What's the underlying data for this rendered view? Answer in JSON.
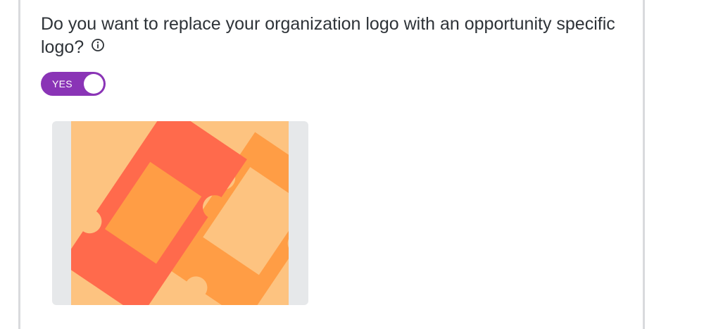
{
  "question": {
    "text": "Do you want to replace your organization logo with an opportunity specific logo?",
    "info_icon": "info-circle-icon"
  },
  "toggle": {
    "label": "YES",
    "state": "on",
    "color": "#8a34b6"
  },
  "logo": {
    "icon": "tickets-icon",
    "colors": {
      "background": "#fdc380",
      "front_ticket": "#ff6a4c",
      "back_ticket": "#ff9d45",
      "frame": "#e6e8ea"
    }
  }
}
